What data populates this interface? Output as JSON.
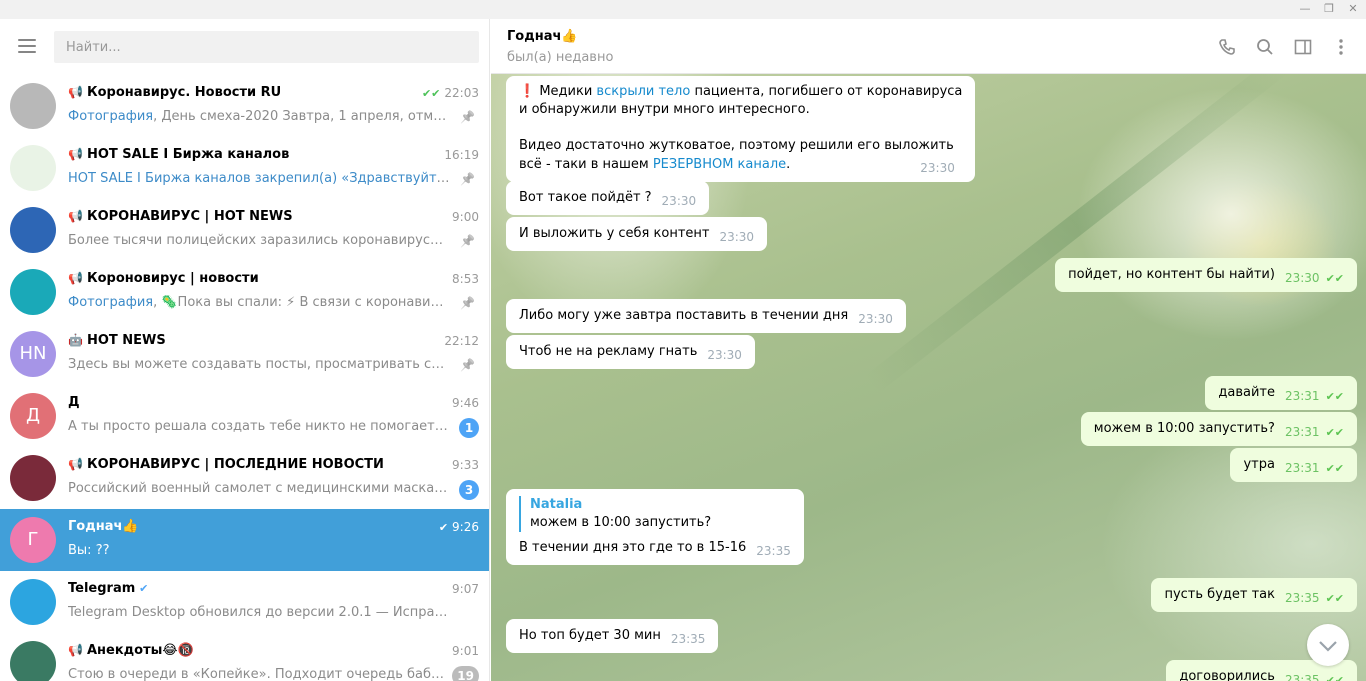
{
  "window": {
    "minimize": "—",
    "restore": "❐"
  },
  "search": {
    "placeholder": "Найти..."
  },
  "chats": [
    {
      "name": "Коронавирус. Новости RU",
      "time": "22:03",
      "preview_hl": "Фотография",
      "preview": ", День смеха-2020  Завтра, 1 апреля, отмечается ...",
      "pinned": true,
      "avatar_color": "#b8b8b8"
    },
    {
      "name": "HOT SALE I Биржа каналов",
      "time": "16:19",
      "preview_hl": "HOT SALE I Биржа каналов закрепил(а) «Здравствуйте. Чт...»",
      "preview": "",
      "pinned": true,
      "avatar_color": "#e9f3e6"
    },
    {
      "name": "КОРОНАВИРУС | HOT NEWS",
      "time": "9:00",
      "preview_hl": "",
      "preview": "Более тысячи полицейских заразились коронавирусом в Нь...",
      "pinned": true,
      "avatar_color": "#2d66b5"
    },
    {
      "name": "Короновирус | новости",
      "time": "8:53",
      "preview_hl": "Фотография",
      "preview": ", 🦠Пока вы спали:  ⚡ В связи с коронавирусо...",
      "pinned": true,
      "avatar_color": "#1aa9b8"
    },
    {
      "name": "HOT NEWS",
      "time": "22:12",
      "preview_hl": "",
      "preview": "Здесь вы можете создавать посты, просматривать статисти...",
      "pinned": true,
      "avatar_color": "#a695e7",
      "initials": "HN"
    },
    {
      "name": "Д",
      "time": "9:46",
      "preview_hl": "",
      "preview": "А ты просто решала создать тебе никто не помогает да?🤔",
      "badge": "1",
      "avatar_color": "#e17076",
      "initials": "Д"
    },
    {
      "name": "КОРОНАВИРУС | ПОСЛЕДНИЕ НОВОСТИ",
      "time": "9:33",
      "preview_hl": "",
      "preview": "Российский военный самолет с медицинскими масками и м...",
      "badge": "3",
      "avatar_color": "#7a2a3a"
    },
    {
      "name": "Годнач👍",
      "time": "9:26",
      "preview_hl": "",
      "preview": "Вы: ??",
      "active": true,
      "avatar_color": "#ee7aae",
      "initials": "Г"
    },
    {
      "name": "Telegram",
      "time": "9:07",
      "preview_hl": "",
      "preview": "Telegram Desktop обновился до версии 2.0.1  — Исправления и у...",
      "avatar_color": "#2ca5e0"
    },
    {
      "name": "Анекдоты😂🔞",
      "time": "9:01",
      "preview_hl": "",
      "preview": "Стою в очереди в «Копейке». Подходит очередь бабули, кот...",
      "badge": "19",
      "avatar_color": "#3a7a63"
    }
  ],
  "header": {
    "title": "Годнач👍",
    "status": "был(а) недавно"
  },
  "messages": {
    "m1": {
      "mark": "❗",
      "a": " Медики ",
      "link1": "вскрыли тело",
      "b": " пациента, погибшего от коронавируса",
      "c": "и обнаружили внутри много интересного.",
      "d": "Видео достаточно жутковатое, поэтому решили его выложить",
      "e": "всё - таки в нашем ",
      "link2": "РЕЗЕРВНОМ канале",
      "f": ".",
      "time": "23:30"
    },
    "m2": {
      "text": "Вот такое пойдёт ?",
      "time": "23:30"
    },
    "m3": {
      "text": "И выложить у себя контент",
      "time": "23:30"
    },
    "m4": {
      "text": "пойдет, но контент бы найти)",
      "time": "23:30"
    },
    "m5": {
      "text": "Либо могу уже завтра поставить в течении дня",
      "time": "23:30"
    },
    "m6": {
      "text": "Чтоб не на рекламу гнать",
      "time": "23:30"
    },
    "m7": {
      "text": "давайте",
      "time": "23:31"
    },
    "m8": {
      "text": "можем в 10:00 запустить?",
      "time": "23:31"
    },
    "m9": {
      "text": "утра",
      "time": "23:31"
    },
    "m10": {
      "reply_name": "Natalia",
      "reply_text": "можем в 10:00 запустить?",
      "text": "В течении дня это где то в 15-16",
      "time": "23:35"
    },
    "m11": {
      "text": "пусть будет так",
      "time": "23:35"
    },
    "m12": {
      "text": "Но топ будет 30 мин",
      "time": "23:35"
    },
    "m13": {
      "text": "договорились",
      "time": "23:35"
    }
  }
}
